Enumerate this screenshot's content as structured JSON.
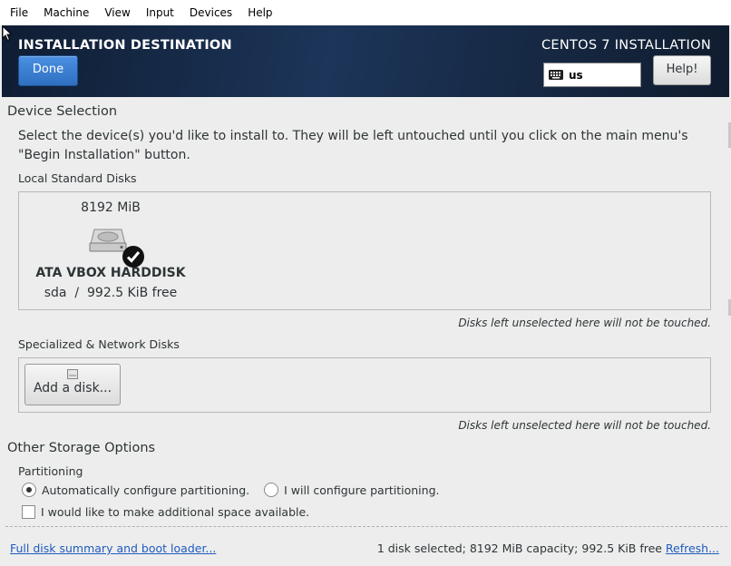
{
  "menubar": {
    "items": [
      "File",
      "Machine",
      "View",
      "Input",
      "Devices",
      "Help"
    ]
  },
  "header": {
    "spoke_title": "INSTALLATION DESTINATION",
    "done_label": "Done",
    "product": "CENTOS 7 INSTALLATION",
    "keyboard_layout": "us",
    "help_label": "Help!"
  },
  "device_selection": {
    "title": "Device Selection",
    "intro": "Select the device(s) you'd like to install to.  They will be left untouched until you click on the main menu's \"Begin Installation\" button.",
    "local_title": "Local Standard Disks",
    "disk": {
      "size": "8192 MiB",
      "name": "ATA VBOX HARDDISK",
      "device": "sda",
      "separator": "/",
      "free": "992.5 KiB free",
      "selected": true
    },
    "local_note": "Disks left unselected here will not be touched.",
    "network_title": "Specialized & Network Disks",
    "add_disk_label": "Add a disk...",
    "network_note": "Disks left unselected here will not be touched."
  },
  "other_storage": {
    "title": "Other Storage Options",
    "partitioning_title": "Partitioning",
    "auto_label": "Automatically configure partitioning.",
    "manual_label": "I will configure partitioning.",
    "selected": "auto",
    "extra_space_label": "I would like to make additional space available.",
    "extra_space_checked": false
  },
  "footer": {
    "summary_link": "Full disk summary and boot loader...",
    "status": "1 disk selected; 8192 MiB capacity; 992.5 KiB free",
    "refresh_label": "Refresh..."
  },
  "colors": {
    "header_bg": "#1c3559",
    "done_button": "#3a7fd5",
    "link": "#1f5bbf",
    "page_bg": "#ededed"
  }
}
